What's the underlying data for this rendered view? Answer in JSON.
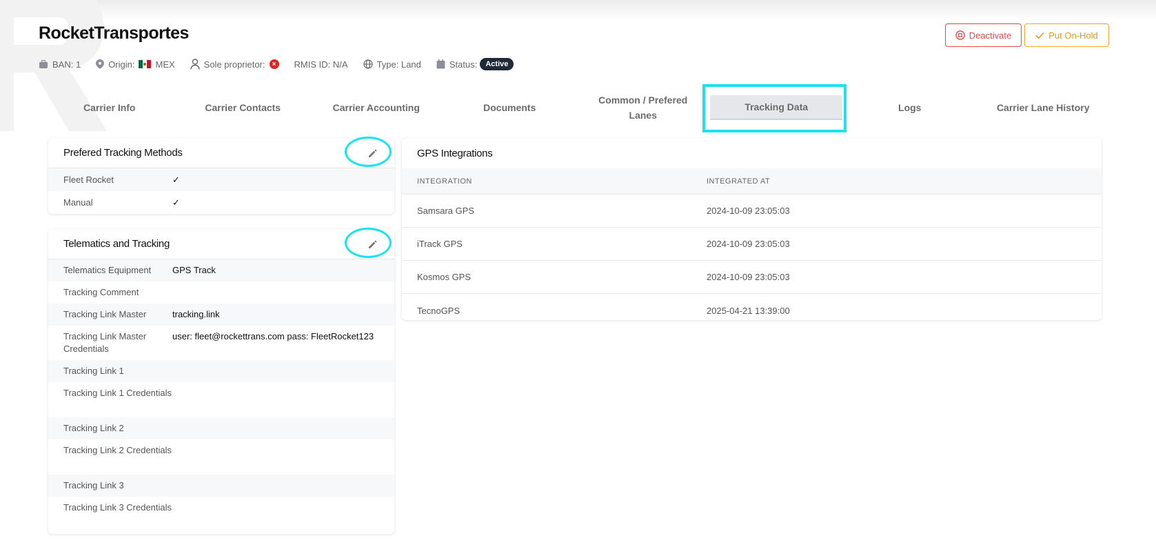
{
  "company": {
    "name": "RocketTransportes"
  },
  "meta": {
    "ban": "BAN: 1",
    "origin_label": "Origin:",
    "origin_country": "MEX",
    "sole_proprietor_label": "Sole proprietor:",
    "rmis": "RMIS ID: N/A",
    "type": "Type: Land",
    "status_label": "Status:",
    "status_value": "Active"
  },
  "actions": {
    "deactivate": "Deactivate",
    "hold": "Put On-Hold"
  },
  "tabs": [
    {
      "label": "Carrier Info"
    },
    {
      "label": "Carrier Contacts"
    },
    {
      "label": "Carrier Accounting"
    },
    {
      "label": "Documents"
    },
    {
      "label": "Common / Prefered Lanes"
    },
    {
      "label": "Tracking Data"
    },
    {
      "label": "Logs"
    },
    {
      "label": "Carrier Lane History"
    }
  ],
  "preferred_tracking": {
    "title": "Prefered Tracking Methods",
    "rows": [
      {
        "label": "Fleet Rocket",
        "value": "✓"
      },
      {
        "label": "Manual",
        "value": "✓"
      }
    ]
  },
  "telematics": {
    "title": "Telematics and Tracking",
    "rows": [
      {
        "label": "Telematics Equipment",
        "value": "GPS Track"
      },
      {
        "label": "Tracking Comment",
        "value": ""
      },
      {
        "label": "Tracking Link Master",
        "value": "tracking.link"
      },
      {
        "label": "Tracking Link Master Credentials",
        "value": "user: fleet@rockettrans.com pass: FleetRocket123"
      },
      {
        "label": "Tracking Link 1",
        "value": ""
      },
      {
        "label": "Tracking Link 1 Credentials",
        "value": ""
      },
      {
        "label": "Tracking Link 2",
        "value": ""
      },
      {
        "label": "Tracking Link 2 Credentials",
        "value": ""
      },
      {
        "label": "Tracking Link 3",
        "value": ""
      },
      {
        "label": "Tracking Link 3 Credentials",
        "value": ""
      }
    ]
  },
  "gps": {
    "title": "GPS Integrations",
    "columns": [
      "INTEGRATION",
      "INTEGRATED AT"
    ],
    "rows": [
      {
        "integration": "Samsara GPS",
        "integrated_at": "2024-10-09 23:05:03"
      },
      {
        "integration": "iTrack GPS",
        "integrated_at": "2024-10-09 23:05:03"
      },
      {
        "integration": "Kosmos GPS",
        "integrated_at": "2024-10-09 23:05:03"
      },
      {
        "integration": "TecnoGPS",
        "integrated_at": "2025-04-21 13:39:00"
      }
    ]
  },
  "colors": {
    "highlight": "#19e3f0",
    "danger": "#e5484d",
    "warning": "#f5a623",
    "active_badge": "#1f2937"
  }
}
